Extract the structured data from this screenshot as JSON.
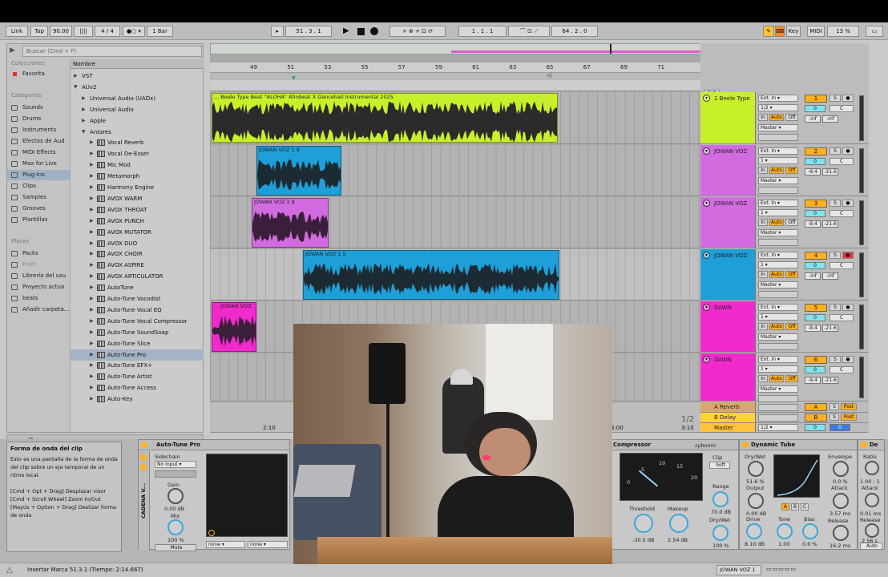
{
  "transport": {
    "link": "Link",
    "tap": "Tap",
    "tempo": "90.00",
    "sig": "4 / 4",
    "quant": "1 Bar",
    "position": "51 .   3 .   1",
    "loop_start": "1 .   1 .   1",
    "loop_len": "64 .   2 .   0",
    "key": "Key",
    "midi": "MIDI",
    "cpu": "13 %"
  },
  "browser": {
    "search_placeholder": "Buscar (Cmd + F)",
    "collections_header": "Colecciones",
    "favorites": "Favorita",
    "categories_header": "Categorías",
    "categories": [
      "Sounds",
      "Drums",
      "Instruments",
      "Efectos de Aud",
      "MIDI Effects",
      "Max for Live",
      "Plug-Ins",
      "Clips",
      "Samples",
      "Grooves",
      "Plantillas"
    ],
    "places_header": "Places",
    "places": [
      "Packs",
      "Push",
      "Librería del usu",
      "Proyecto actua",
      "beats",
      "Añadir carpeta..."
    ],
    "column_name": "Nombre",
    "tree": [
      {
        "label": "VST",
        "level": 0,
        "arrow": "▶"
      },
      {
        "label": "AUv2",
        "level": 0,
        "arrow": "▼"
      },
      {
        "label": "Universal Audio (UADx)",
        "level": 1,
        "arrow": "▶"
      },
      {
        "label": "Universal Audio",
        "level": 1,
        "arrow": "▶"
      },
      {
        "label": "Apple",
        "level": 1,
        "arrow": "▶"
      },
      {
        "label": "Antares",
        "level": 1,
        "arrow": "▼"
      },
      {
        "label": "Vocal Reverb",
        "level": 2,
        "arrow": "▶"
      },
      {
        "label": "Vocal De-Esser",
        "level": 2,
        "arrow": "▶"
      },
      {
        "label": "Mic Mod",
        "level": 2,
        "arrow": "▶"
      },
      {
        "label": "Metamorph",
        "level": 2,
        "arrow": "▶"
      },
      {
        "label": "Harmony Engine",
        "level": 2,
        "arrow": "▶"
      },
      {
        "label": "AVOX WARM",
        "level": 2,
        "arrow": "▶"
      },
      {
        "label": "AVOX THROAT",
        "level": 2,
        "arrow": "▶"
      },
      {
        "label": "AVOX PUNCH",
        "level": 2,
        "arrow": "▶"
      },
      {
        "label": "AVOX MUTATOR",
        "level": 2,
        "arrow": "▶"
      },
      {
        "label": "AVOX DUO",
        "level": 2,
        "arrow": "▶"
      },
      {
        "label": "AVOX CHOIR",
        "level": 2,
        "arrow": "▶"
      },
      {
        "label": "AVOX ASPIRE",
        "level": 2,
        "arrow": "▶"
      },
      {
        "label": "AVOX ARTICULATOR",
        "level": 2,
        "arrow": "▶"
      },
      {
        "label": "AutoTune",
        "level": 2,
        "arrow": "▶"
      },
      {
        "label": "Auto-Tune Vocodist",
        "level": 2,
        "arrow": "▶"
      },
      {
        "label": "Auto-Tune Vocal EQ",
        "level": 2,
        "arrow": "▶"
      },
      {
        "label": "Auto-Tune Vocal Compressor",
        "level": 2,
        "arrow": "▶"
      },
      {
        "label": "Auto-Tune SoundSoap",
        "level": 2,
        "arrow": "▶"
      },
      {
        "label": "Auto-Tune Slice",
        "level": 2,
        "arrow": "▶"
      },
      {
        "label": "Auto-Tune Pro",
        "level": 2,
        "arrow": "▶",
        "selected": true
      },
      {
        "label": "Auto-Tune EFX+",
        "level": 2,
        "arrow": "▶"
      },
      {
        "label": "Auto-Tune Artist",
        "level": 2,
        "arrow": "▶"
      },
      {
        "label": "Auto-Tune Access",
        "level": 2,
        "arrow": "▶"
      },
      {
        "label": "Auto-Key",
        "level": 2,
        "arrow": "▶"
      }
    ]
  },
  "ruler": {
    "bars": [
      "49",
      "51",
      "53",
      "55",
      "57",
      "59",
      "61",
      "63",
      "65",
      "67",
      "69",
      "71"
    ],
    "page": "1/2",
    "times": [
      "2:10",
      "3:00",
      "3:10"
    ]
  },
  "clips": {
    "c1": "... Beele Type Beat \"ALOHA\" Afrobeat X Dancehall Instrumental 2025",
    "c2": "JOWAN VOZ 1 9",
    "c3": "JOWAN VOZ 1 8",
    "c4": "JOWAN VOZ 1 5",
    "c5": "... JOWAN VOZ"
  },
  "mixer": {
    "set": "Set",
    "tracks": [
      {
        "name": "1 Beele Type",
        "color": "#c8f02a",
        "num": "1",
        "in": "Ext. In",
        "ch": "1/2",
        "out": "Master",
        "v1": "-inf",
        "v2": "-inf",
        "pan": "C",
        "vol": "0"
      },
      {
        "name": "JOWAN VOZ",
        "color": "#d36be0",
        "num": "2",
        "in": "Ext. In",
        "ch": "1",
        "out": "Master",
        "v1": "-9.4",
        "v2": "-21.6",
        "pan": "C",
        "vol": "0"
      },
      {
        "name": "JOWAN VOZ",
        "color": "#d36be0",
        "num": "3",
        "in": "Ext. In",
        "ch": "1",
        "out": "Master",
        "v1": "-9.4",
        "v2": "-21.6",
        "pan": "C",
        "vol": "0"
      },
      {
        "name": "JOWAN VOZ",
        "color": "#1e9fd8",
        "num": "4",
        "in": "Ext. In",
        "ch": "1",
        "out": "Master",
        "v1": "-inf",
        "v2": "-inf",
        "pan": "C",
        "vol": "0"
      },
      {
        "name": "DAWN",
        "color": "#f02acd",
        "num": "5",
        "in": "Ext. In",
        "ch": "1",
        "out": "Master",
        "v1": "-9.4",
        "v2": "-21.6",
        "pan": "C",
        "vol": "0"
      },
      {
        "name": "DAWN",
        "color": "#f02acd",
        "num": "6",
        "in": "Ext. In",
        "ch": "1",
        "out": "Master",
        "v1": "-9.4",
        "v2": "-21.6",
        "pan": "C",
        "vol": "0"
      }
    ],
    "in": "In",
    "auto": "Auto",
    "off": "Off",
    "s": "S",
    "returns": [
      {
        "name": "A Reverb",
        "letter": "A"
      },
      {
        "name": "B Delay",
        "letter": "B"
      }
    ],
    "post": "Post",
    "master": {
      "name": "Master",
      "ch": "1/2",
      "vol": "0",
      "v2": "0"
    }
  },
  "info": {
    "title": "Forma de onda del clip",
    "body": "Esto es una pantalla de la forma de onda del clip sobre un eje temporal de un ritmo local.",
    "l1": "[Cmd + Opt + Drag] Desplazar visor",
    "l2": "[Cmd + Scroll Wheel] Zoom In/Out",
    "l3": "[Mayús + Option + Drag] Deslizar forma de onda"
  },
  "devices": {
    "autotune": {
      "title": "Auto-Tune Pro",
      "chain": "CADENA V...",
      "sidechain": "Sidechain",
      "noinput": "No Input",
      "gain": "Gain",
      "gain_val": "0.00 dB",
      "mix": "Mix",
      "mix_val": "100 %",
      "mute": "Mute",
      "none1": "none",
      "none2": "none"
    },
    "compressor": {
      "title": "Compressor",
      "brand": "sybomic",
      "clip": "Clip",
      "soft": "Soft",
      "threshold": "Threshold",
      "th_val": "-30.5 dB",
      "makeup": "Makeup",
      "mk_val": "2.54 dB",
      "range": "Range",
      "range_val": "70.0 dB",
      "drywet": "Dry/Wet",
      "dw_val": "100 %",
      "scale": [
        "0",
        "5",
        "10",
        "15",
        "20"
      ]
    },
    "tube": {
      "title": "Dynamic Tube",
      "drywet": "Dry/Wet",
      "dw_val": "51.6 %",
      "output": "Output",
      "out_val": "0.00 dB",
      "drive": "Drive",
      "drive_val": "8.10 dB",
      "tone": "Tone",
      "tone_val": "1.00",
      "bias": "Bias",
      "bias_val": "0.0 %",
      "envelope": "Envelope",
      "env_val": "0.0 %",
      "attack": "Attack",
      "att_val": "3.57 ms",
      "release": "Release",
      "rel_val": "16.2 ms",
      "a": "A",
      "b": "B",
      "c": "C"
    },
    "last": {
      "title": "De",
      "ratio": "Ratio",
      "ratio_val": "1.00 : 1",
      "attack": "Attack",
      "att_val": "0.01 ms",
      "release": "Release",
      "rel_val": "2.56 s",
      "auto": "Auto"
    }
  },
  "status": {
    "text": "Insertar Marca 51.3.1 (Tiempo: 2:14.667)",
    "track": "JOWAN VOZ 1"
  }
}
